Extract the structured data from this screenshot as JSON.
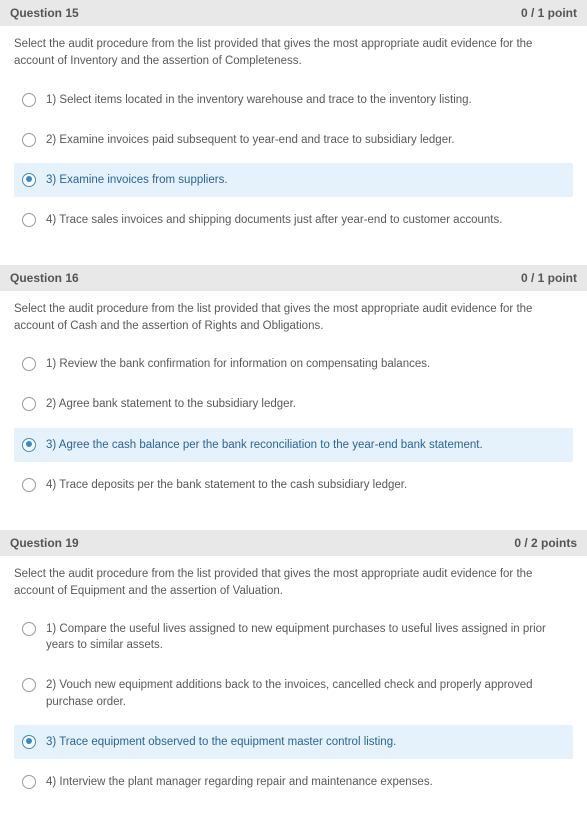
{
  "questions": [
    {
      "title": "Question 15",
      "score": "0 / 1 point",
      "prompt": "Select the audit procedure from the list provided that gives the most appropriate audit evidence for the account of Inventory and the assertion of Completeness.",
      "options": [
        {
          "label": "1) Select items located in the inventory warehouse and trace to the inventory listing.",
          "selected": false
        },
        {
          "label": "2) Examine invoices paid subsequent to year-end and trace to subsidiary ledger.",
          "selected": false
        },
        {
          "label": "3) Examine invoices from suppliers.",
          "selected": true
        },
        {
          "label": "4) Trace sales invoices and shipping documents just after year-end to customer accounts.",
          "selected": false
        }
      ]
    },
    {
      "title": "Question 16",
      "score": "0 / 1 point",
      "prompt": "Select the audit procedure from the list provided that gives the most appropriate audit evidence for the account of Cash and the assertion of Rights and Obligations.",
      "options": [
        {
          "label": "1) Review the bank confirmation for information on compensating balances.",
          "selected": false
        },
        {
          "label": "2) Agree bank statement to the subsidiary ledger.",
          "selected": false
        },
        {
          "label": "3) Agree the cash balance per the bank reconciliation to the year-end bank statement.",
          "selected": true
        },
        {
          "label": "4) Trace deposits per the bank statement to the cash subsidiary ledger.",
          "selected": false
        }
      ]
    },
    {
      "title": "Question 19",
      "score": "0 / 2 points",
      "prompt": "Select the audit procedure from the list provided that gives the most appropriate audit evidence for the account of Equipment and the assertion of Valuation.",
      "options": [
        {
          "label": "1) Compare the useful lives assigned to new equipment purchases to useful lives assigned in prior years to similar assets.",
          "selected": false
        },
        {
          "label": "2) Vouch new equipment additions back to the invoices, cancelled check and properly approved purchase order.",
          "selected": false
        },
        {
          "label": "3) Trace equipment observed to the equipment master control listing.",
          "selected": true
        },
        {
          "label": "4) Interview the plant manager regarding repair and maintenance expenses.",
          "selected": false
        }
      ]
    }
  ]
}
